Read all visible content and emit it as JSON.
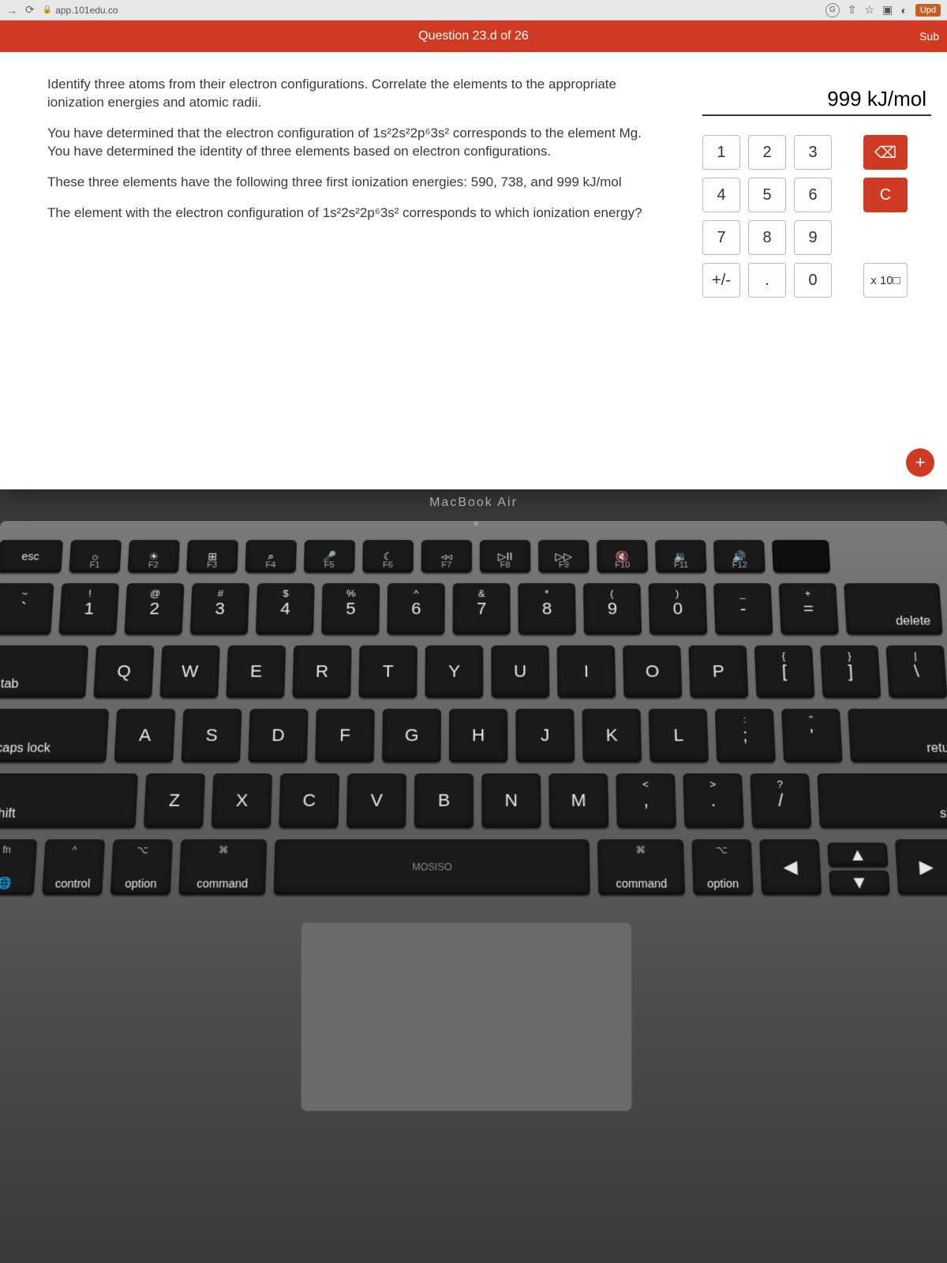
{
  "browser": {
    "url": "app.101edu.co",
    "upd_label": "Upd"
  },
  "quiz": {
    "header": "Question 23.d of 26",
    "sub": "Sub",
    "paragraphs": {
      "p1": "Identify three atoms from their electron configurations. Correlate the elements to the appropriate ionization energies and atomic radii.",
      "p2": "You have determined that the electron configuration of 1s²2s²2p⁶3s² corresponds to the element Mg. You have determined the identity of three elements based on electron configurations.",
      "p3": "These three elements have the following three first ionization energies: 590, 738, and 999 kJ/mol",
      "p4": "The element with the electron configuration of 1s²2s²2p⁶3s² corresponds to which ionization energy?"
    },
    "answer_display": "999  kJ/mol",
    "keypad": {
      "keys": [
        "1",
        "2",
        "3",
        "4",
        "5",
        "6",
        "7",
        "8",
        "9",
        "+/-",
        ".",
        "0"
      ],
      "backspace": "⌫",
      "clear": "C",
      "sci": "x 10□",
      "plus": "+"
    }
  },
  "laptop": {
    "model": "MacBook Air",
    "fn_row": [
      {
        "icon": "esc",
        "sub": ""
      },
      {
        "icon": "☼",
        "sub": "F1"
      },
      {
        "icon": "☀",
        "sub": "F2"
      },
      {
        "icon": "⊞",
        "sub": "F3"
      },
      {
        "icon": "⌕",
        "sub": "F4"
      },
      {
        "icon": "🎤",
        "sub": "F5"
      },
      {
        "icon": "☾",
        "sub": "F6"
      },
      {
        "icon": "◃◃",
        "sub": "F7"
      },
      {
        "icon": "▷II",
        "sub": "F8"
      },
      {
        "icon": "▷▷",
        "sub": "F9"
      },
      {
        "icon": "🔇",
        "sub": "F10"
      },
      {
        "icon": "🔉",
        "sub": "F11"
      },
      {
        "icon": "🔊",
        "sub": "F12"
      }
    ],
    "num_row": [
      {
        "top": "~",
        "bot": "`"
      },
      {
        "top": "!",
        "bot": "1"
      },
      {
        "top": "@",
        "bot": "2"
      },
      {
        "top": "#",
        "bot": "3"
      },
      {
        "top": "$",
        "bot": "4"
      },
      {
        "top": "%",
        "bot": "5"
      },
      {
        "top": "^",
        "bot": "6"
      },
      {
        "top": "&",
        "bot": "7"
      },
      {
        "top": "*",
        "bot": "8"
      },
      {
        "top": "(",
        "bot": "9"
      },
      {
        "top": ")",
        "bot": "0"
      },
      {
        "top": "_",
        "bot": "-"
      },
      {
        "top": "+",
        "bot": "="
      }
    ],
    "delete": "delete",
    "tab": "tab",
    "qwerty": [
      "Q",
      "W",
      "E",
      "R",
      "T",
      "Y",
      "U",
      "I",
      "O",
      "P"
    ],
    "bracket_l": {
      "top": "{",
      "bot": "["
    },
    "bracket_r": {
      "top": "}",
      "bot": "]"
    },
    "backslash": {
      "top": "|",
      "bot": "\\"
    },
    "caps": "caps lock",
    "asdf": [
      "A",
      "S",
      "D",
      "F",
      "G",
      "H",
      "J",
      "K",
      "L"
    ],
    "semicolon": {
      "top": ":",
      "bot": ";"
    },
    "quote": {
      "top": "\"",
      "bot": "'"
    },
    "return": "return",
    "shift": "shift",
    "zxcv": [
      "Z",
      "X",
      "C",
      "V",
      "B",
      "N",
      "M"
    ],
    "comma": {
      "top": "<",
      "bot": ","
    },
    "period": {
      "top": ">",
      "bot": "."
    },
    "slash": {
      "top": "?",
      "bot": "/"
    },
    "ctrl": "control",
    "option": "option",
    "command": "command",
    "fn": "fn",
    "mosiso": "MOSISO",
    "cmd_sym": "⌘",
    "opt_sym": "⌥",
    "ctrl_sym": "^"
  }
}
